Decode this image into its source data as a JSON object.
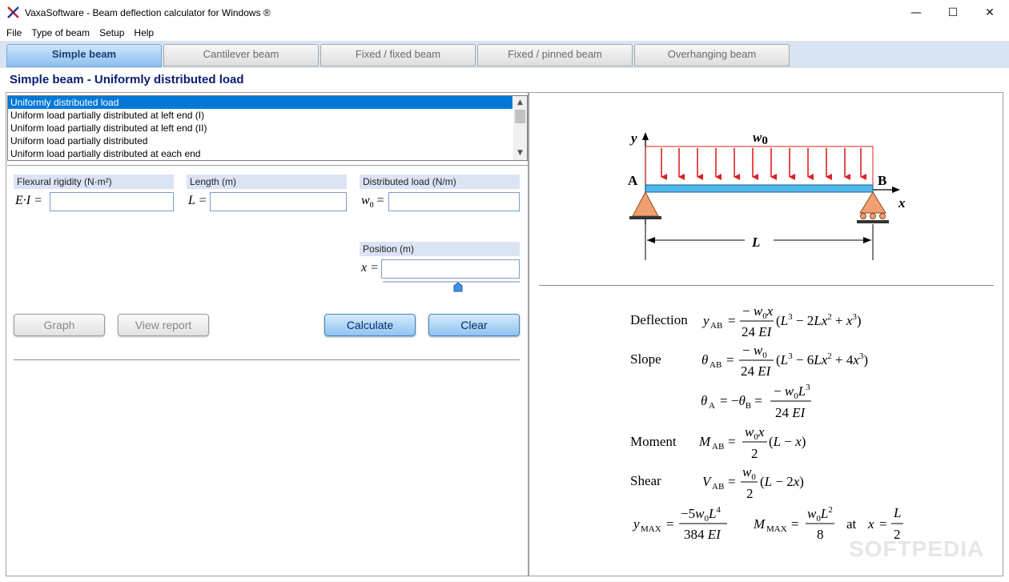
{
  "window": {
    "title": "VaxaSoftware - Beam deflection calculator for Windows ®",
    "minimize": "—",
    "maximize": "☐",
    "close": "✕"
  },
  "menu": [
    "File",
    "Type of beam",
    "Setup",
    "Help"
  ],
  "tabs": [
    {
      "label": "Simple beam",
      "active": true
    },
    {
      "label": "Cantilever beam",
      "active": false
    },
    {
      "label": "Fixed / fixed beam",
      "active": false
    },
    {
      "label": "Fixed / pinned beam",
      "active": false
    },
    {
      "label": "Overhanging beam",
      "active": false
    }
  ],
  "heading": "Simple beam - Uniformly distributed load",
  "load_list": {
    "items": [
      "Uniformly distributed load",
      "Uniform load partially distributed at left end (I)",
      "Uniform load partially distributed at left end (II)",
      "Uniform load partially distributed",
      "Uniform load partially distributed at each end"
    ],
    "selected": "Uniformly distributed load"
  },
  "fields": {
    "rigidity": {
      "label": "Flexural rigidity (N·m²)",
      "symbol": "E·I =",
      "value": ""
    },
    "length": {
      "label": "Length (m)",
      "symbol": "L =",
      "value": ""
    },
    "load": {
      "label": "Distributed load (N/m)",
      "symbol": "w",
      "symbol_sub": "0",
      "symbol_tail": "=",
      "value": ""
    },
    "position": {
      "label": "Position (m)",
      "symbol": "x =",
      "value": "",
      "slider_fraction": 0.55
    }
  },
  "buttons": {
    "graph": "Graph",
    "view_report": "View report",
    "calculate": "Calculate",
    "clear": "Clear"
  },
  "diagram": {
    "y": "y",
    "x": "x",
    "w": "w",
    "w_sub": "0",
    "A": "A",
    "B": "B",
    "L": "L"
  },
  "formulas": {
    "deflection": "Deflection",
    "slope": "Slope",
    "moment": "Moment",
    "shear": "Shear",
    "at": "at"
  },
  "watermark": "SOFTPEDIA",
  "colors": {
    "accent": "#0078d7",
    "heading": "#0a1c73",
    "arrow": "#e02020",
    "beam": "#4db8ec",
    "support": "#f0a070"
  }
}
